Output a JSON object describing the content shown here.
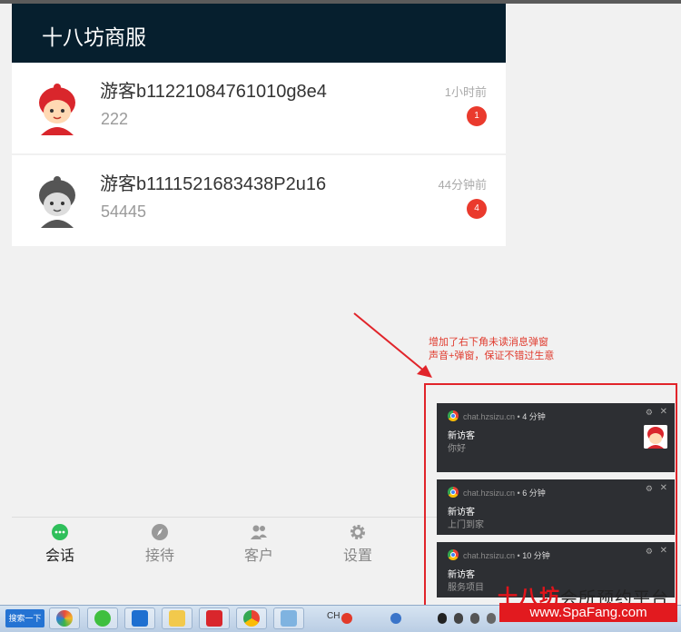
{
  "app": {
    "title": "十八坊商服",
    "conversations": [
      {
        "name": "游客b11221084761010g8e4",
        "message": "222",
        "time": "1小时前",
        "unread": "1"
      },
      {
        "name": "游客b1111521683438P2u16",
        "message": "54445",
        "time": "44分钟前",
        "unread": "4"
      }
    ],
    "tabs": [
      {
        "label": "会话",
        "icon": "chat-bubble-icon",
        "active": true
      },
      {
        "label": "接待",
        "icon": "compass-icon",
        "active": false
      },
      {
        "label": "客户",
        "icon": "users-icon",
        "active": false
      },
      {
        "label": "设置",
        "icon": "gear-icon",
        "active": false
      }
    ]
  },
  "annotation": {
    "line1": "增加了右下角未读消息弹窗",
    "line2": "声音+弹窗，保证不错过生意"
  },
  "notifications": [
    {
      "site": "chat.hzsizu.cn",
      "bullet": "•",
      "time": "4 分钟",
      "title": "新访客",
      "body": "你好",
      "has_thumb": true
    },
    {
      "site": "chat.hzsizu.cn",
      "bullet": "•",
      "time": "6 分钟",
      "title": "新访客",
      "body": "上门到家",
      "has_thumb": false
    },
    {
      "site": "chat.hzsizu.cn",
      "bullet": "•",
      "time": "10 分钟",
      "title": "新访客",
      "body": "服务项目",
      "has_thumb": false
    }
  ],
  "notification_icons": {
    "settings": "⚙",
    "close": "✕"
  },
  "taskbar": {
    "search_label": "搜索一下",
    "tray_text": "CH"
  },
  "watermark": {
    "brand": "十八坊",
    "tagline": "会所预约平台",
    "url": "www.SpaFang.com"
  },
  "colors": {
    "header": "#061f2e",
    "badge": "#ea3a2d",
    "accent_red": "#e1242a",
    "active_tab_icon": "#2fbf5b"
  }
}
